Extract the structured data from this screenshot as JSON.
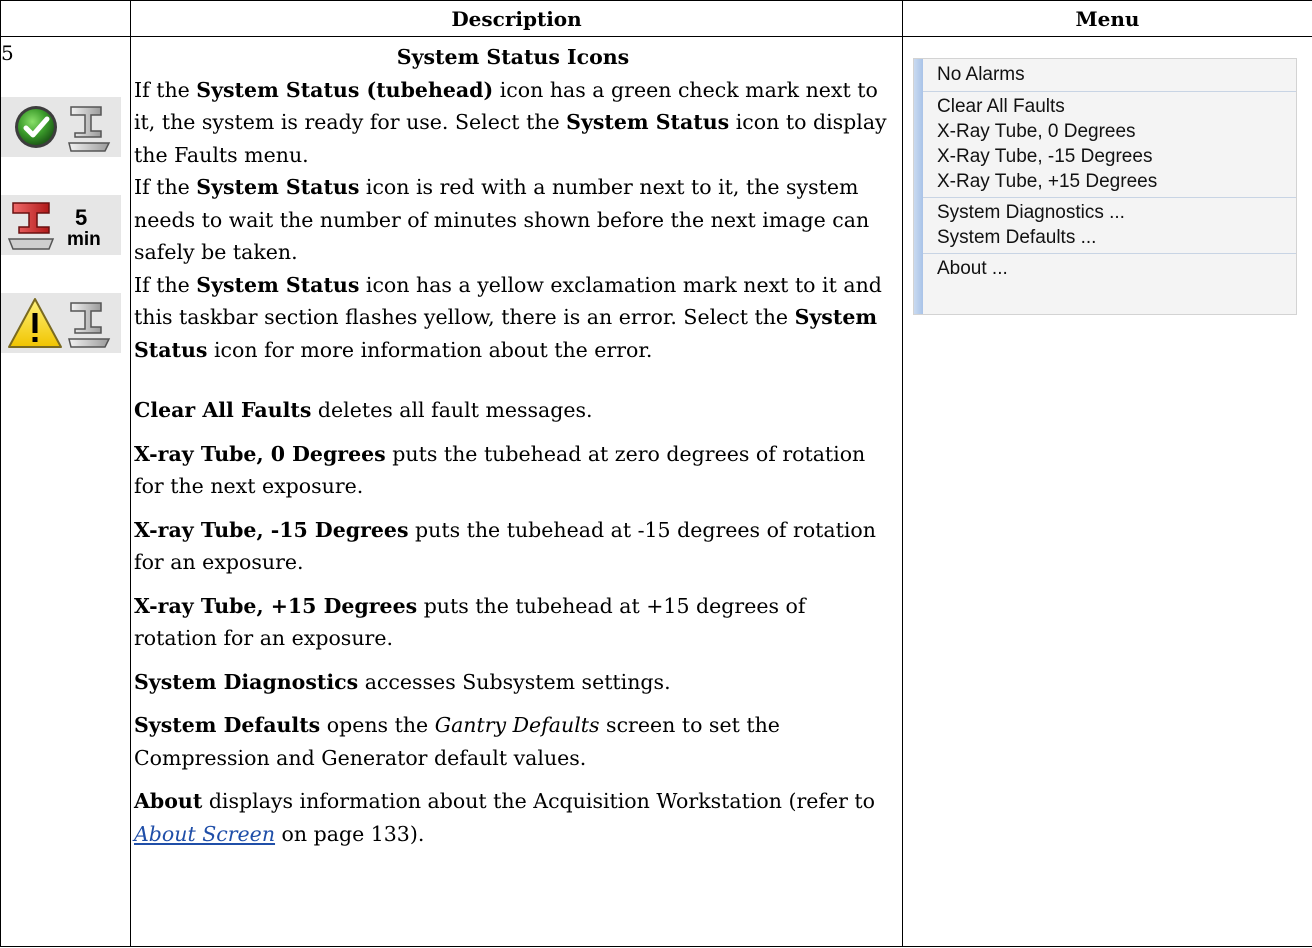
{
  "table": {
    "headers": [
      "",
      "Description",
      "Menu"
    ],
    "row_number": "5"
  },
  "description": {
    "heading": "System Status Icons",
    "p1": [
      "If the ",
      "System Status (tubehead)",
      " icon has a green check mark next to it, the system is ready for use. Select the ",
      "System Status",
      " icon to display the Faults menu."
    ],
    "p2": [
      "If the ",
      "System Status",
      " icon is red with a number next to it, the system needs to wait the number of minutes shown before the next image can safely be taken."
    ],
    "p3": [
      "If the ",
      "System Status",
      " icon has a yellow exclamation mark next to it and this taskbar section flashes yellow, there is an error. Select the ",
      "System Status",
      " icon for more information about the error."
    ],
    "items": [
      {
        "term": "Clear All Faults",
        "text": " deletes all fault messages."
      },
      {
        "term": "X-ray Tube, 0 Degrees",
        "text": " puts the tubehead at zero degrees of rotation for the next exposure."
      },
      {
        "term": "X-ray Tube, -15 Degrees",
        "text": " puts the tubehead at -15 degrees of rotation for an exposure."
      },
      {
        "term": "X-ray Tube, +15 Degrees",
        "text": " puts the tubehead at +15 degrees of rotation for an exposure."
      },
      {
        "term": "System Diagnostics",
        "text": " accesses Subsystem settings."
      }
    ],
    "defaults": {
      "term": "System Defaults",
      "pre": " opens the ",
      "em": "Gantry Defaults",
      "post": " screen to set the Compression and Generator default values."
    },
    "about": {
      "term": "About",
      "pre": " displays information about the Acquisition Workstation (refer to ",
      "link": "About Screen",
      "post": " on page 133)."
    }
  },
  "icons": {
    "ready": "green-check-tubehead-icon",
    "wait": "red-tubehead-timer-icon",
    "wait_value": "5",
    "wait_unit": "min",
    "error": "yellow-warning-tubehead-icon"
  },
  "menu": {
    "items": [
      "No Alarms",
      "Clear All Faults",
      "X-Ray Tube, 0 Degrees",
      "X-Ray Tube, -15 Degrees",
      "X-Ray Tube, +15 Degrees",
      "System Diagnostics ...",
      "System Defaults ...",
      "About ..."
    ],
    "accent": "#a9c3e8"
  }
}
